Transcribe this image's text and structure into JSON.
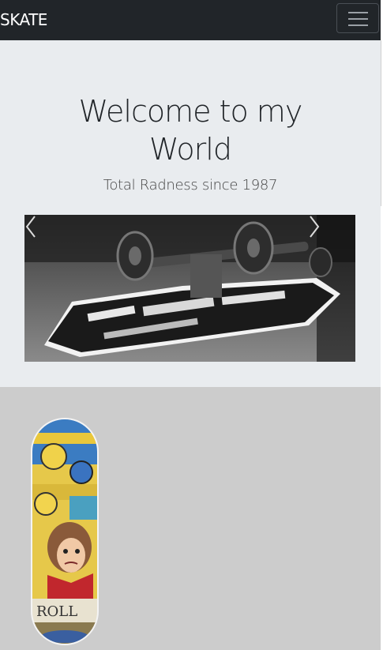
{
  "navbar": {
    "brand": "SKATE",
    "toggle_icon": "hamburger-menu-icon"
  },
  "hero": {
    "title_line1": "Welcome to my",
    "title_line2": "World",
    "lead": "Total Radness since 1987"
  },
  "carousel": {
    "image": "skateboard-photo",
    "prev_icon": "chevron-left-icon",
    "next_icon": "chevron-right-icon"
  },
  "product": {
    "image": "skateboard-deck-image"
  },
  "colors": {
    "navbar_bg": "#212529",
    "jumbotron_bg": "#e9ecef",
    "section_bg": "#cccccc"
  }
}
